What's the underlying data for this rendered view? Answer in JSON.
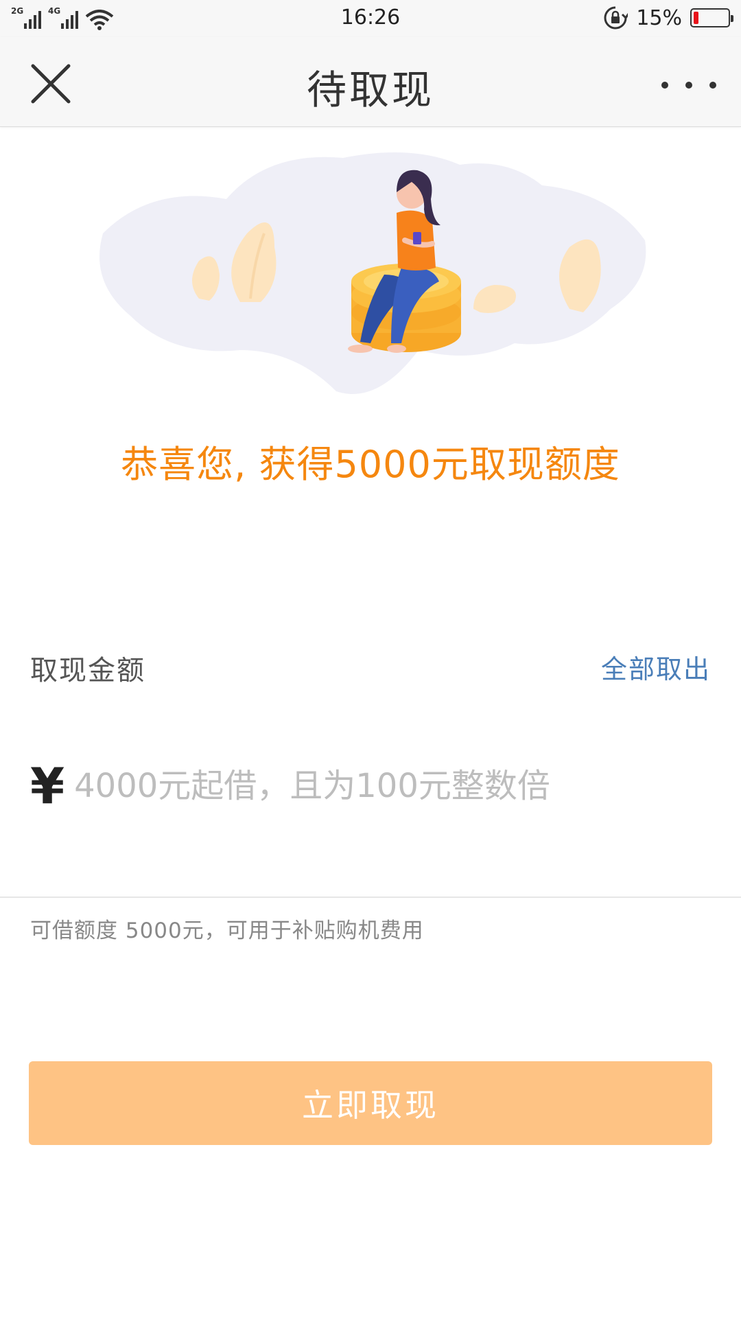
{
  "status_bar": {
    "network_1": "2G",
    "network_2": "4G",
    "time": "16:26",
    "battery_percent": "15%",
    "battery_level": 0.15,
    "battery_color": "#e8141b"
  },
  "nav": {
    "title": "待取现",
    "close_icon": "close-icon",
    "more_icon": "more-icon"
  },
  "congrats_text": "恭喜您, 获得5000元取现额度",
  "form": {
    "amount_label": "取现金额",
    "withdraw_all_label": "全部取出",
    "currency_symbol": "¥",
    "amount_placeholder": "4000元起借，且为100元整数倍",
    "amount_value": "",
    "hint": "可借额度 5000元，可用于补贴购机费用"
  },
  "submit_label": "立即取现",
  "colors": {
    "accent": "#f5870f",
    "link": "#4a7eb8",
    "button_bg": "#fec384"
  }
}
